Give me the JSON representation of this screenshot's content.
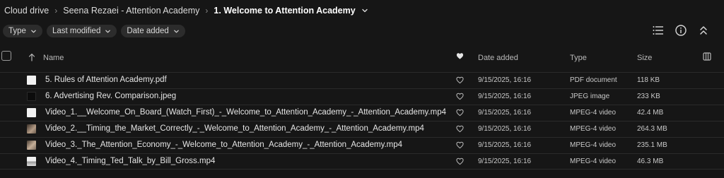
{
  "breadcrumb": {
    "items": [
      "Cloud drive",
      "Seena Rezaei - Attention Academy"
    ],
    "current": "1. Welcome to Attention Academy"
  },
  "filters": [
    {
      "label": "Type"
    },
    {
      "label": "Last modified"
    },
    {
      "label": "Date added"
    }
  ],
  "toolbar_icons": [
    "list-view-icon",
    "info-icon",
    "collapse-icon"
  ],
  "table": {
    "columns": {
      "name": "Name",
      "date_added": "Date added",
      "type": "Type",
      "size": "Size"
    },
    "sort": {
      "column": "name",
      "direction": "asc"
    },
    "rows": [
      {
        "name": "5. Rules of Attention Academy.pdf",
        "date": "9/15/2025, 16:16",
        "type": "PDF document",
        "size": "118 KB",
        "thumb": "document",
        "thumb_color": "#f2f2f2"
      },
      {
        "name": "6. Advertising Rev. Comparison.jpeg",
        "date": "9/15/2025, 16:16",
        "type": "JPEG image",
        "size": "233 KB",
        "thumb": "image",
        "thumb_color": "#1a1a1a"
      },
      {
        "name": "Video_1.__Welcome_On_Board_(Watch_First)_-_Welcome_to_Attention_Academy_-_Attention_Academy.mp4",
        "date": "9/15/2025, 16:16",
        "type": "MPEG-4 video",
        "size": "42.4 MB",
        "thumb": "video",
        "thumb_color": "#f2f2f2"
      },
      {
        "name": "Video_2.__Timing_the_Market_Correctly_-_Welcome_to_Attention_Academy_-_Attention_Academy.mp4",
        "date": "9/15/2025, 16:16",
        "type": "MPEG-4 video",
        "size": "264.3 MB",
        "thumb": "video",
        "thumb_color": "#8a7a6c"
      },
      {
        "name": "Video_3._The_Attention_Economy_-_Welcome_to_Attention_Academy_-_Attention_Academy.mp4",
        "date": "9/15/2025, 16:16",
        "type": "MPEG-4 video",
        "size": "235.1 MB",
        "thumb": "video",
        "thumb_color": "#9a8a7a"
      },
      {
        "name": "Video_4._Timing_Ted_Talk_by_Bill_Gross.mp4",
        "date": "9/15/2025, 16:16",
        "type": "MPEG-4 video",
        "size": "46.3 MB",
        "thumb": "video",
        "thumb_color": "#d8d8d8"
      }
    ]
  },
  "colors": {
    "background": "#161616",
    "chip": "#2c2c2c",
    "divider": "#2a2a2a",
    "text": "#e6e6e6"
  }
}
